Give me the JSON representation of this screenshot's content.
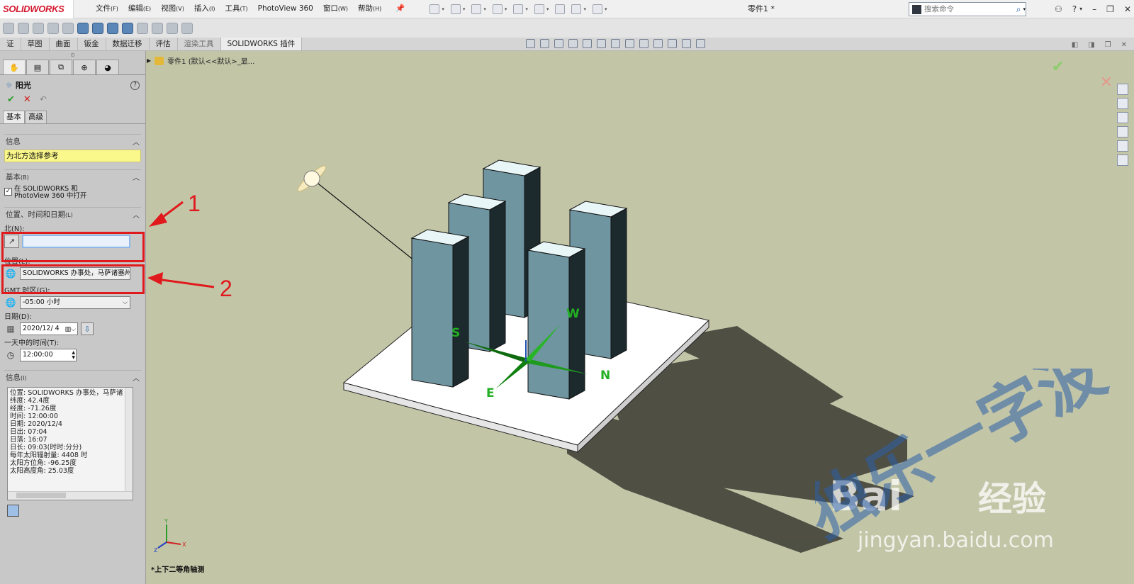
{
  "app": {
    "logo": "SOLIDWORKS",
    "document_title": "零件1 *"
  },
  "menu": [
    {
      "label": "文件",
      "key": "(F)"
    },
    {
      "label": "编辑",
      "key": "(E)"
    },
    {
      "label": "视图",
      "key": "(V)"
    },
    {
      "label": "插入",
      "key": "(I)"
    },
    {
      "label": "工具",
      "key": "(T)"
    },
    {
      "label": "PhotoView 360",
      "key": ""
    },
    {
      "label": "窗口",
      "key": "(W)"
    },
    {
      "label": "帮助",
      "key": "(H)"
    }
  ],
  "search": {
    "placeholder": "搜索命令"
  },
  "command_tabs": [
    "证",
    "草图",
    "曲面",
    "钣金",
    "数据迁移",
    "评估",
    "渲染工具",
    "SOLIDWORKS 插件"
  ],
  "feature_tree": {
    "root": "零件1  (默认<<默认>_显..."
  },
  "property_manager": {
    "title": "阳光",
    "tabs": [
      "基本",
      "高级"
    ],
    "sections": {
      "info_header": "信息",
      "info_message": "为北方选择参考",
      "basic_header": "基本",
      "basic_key": "(B)",
      "basic_checkbox": "在 SOLIDWORKS 和 PhotoView 360 中打开",
      "location_header": "位置、时间和日期",
      "location_key": "(L)",
      "north_label": "北(N):",
      "location_label": "位置(L):",
      "location_value": "SOLIDWORKS 办事处，马萨诸塞州",
      "gmt_label": "GMT 时区(G):",
      "gmt_value": "-05:00 小时",
      "date_label": "日期(D):",
      "date_value": "2020/12/ 4",
      "time_label": "一天中的时间(T):",
      "time_value": "12:00:00",
      "info2_header": "信息",
      "info2_key": "(I)"
    },
    "info_lines": [
      "位置: SOLIDWORKS 办事处，马萨诸",
      "纬度: 42.4度",
      "经度: -71.26度",
      "时间: 12:00:00",
      "日期: 2020/12/4",
      "日出: 07:04",
      "日落: 16:07",
      "日长: 09:03(时时:分分)",
      "每年太阳辐射量: 4408 时",
      "太阳方位角: -96.25度",
      "太阳高度角: 25.03度"
    ]
  },
  "annotations": {
    "label_1": "1",
    "label_2": "2"
  },
  "compass": {
    "s": "S",
    "w": "W",
    "n": "N",
    "e": "E"
  },
  "triad": {
    "x": "X",
    "y": "Y",
    "z": "Z"
  },
  "view_name": "*上下二等角轴测",
  "watermark": {
    "baidu": "Bai",
    "jingyan": "经验",
    "url": "jingyan.baidu.com",
    "author": "独乐一字波"
  },
  "colors": {
    "red_annotation": "#e0191c",
    "viewport_bg": "#c3c5a7",
    "building_face": "#6f95a1",
    "building_side": "#1c2a2e",
    "building_top": "#e8f6f8",
    "compass_green": "#22b022",
    "info_yellow": "#fbf88b"
  }
}
